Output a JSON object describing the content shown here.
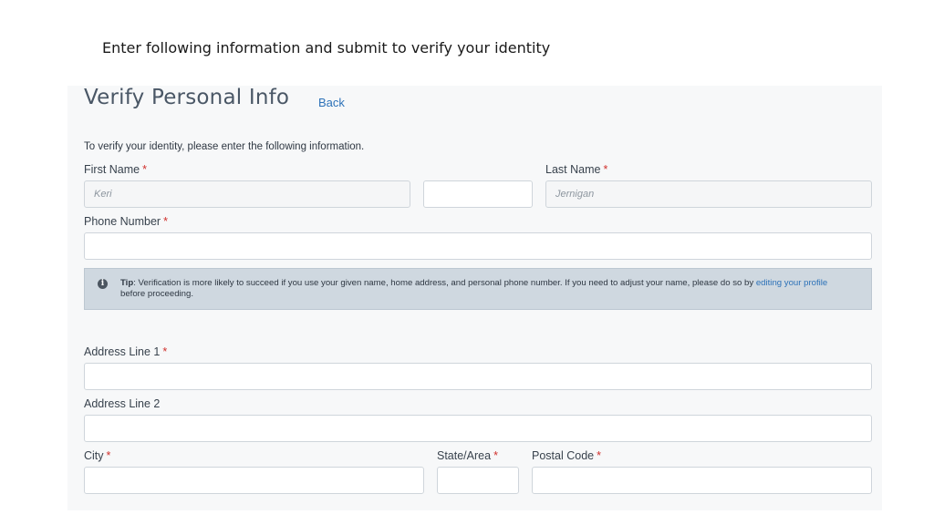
{
  "caption": "Enter following information and submit to verify your identity",
  "form": {
    "title": "Verify Personal Info",
    "back_label": "Back",
    "intro": "To verify your identity, please enter the following information.",
    "required_marker": "*",
    "fields": {
      "first_name": {
        "label": "First Name",
        "placeholder": "Keri",
        "value": ""
      },
      "middle_name": {
        "placeholder": "",
        "value": ""
      },
      "last_name": {
        "label": "Last Name",
        "placeholder": "Jernigan",
        "value": ""
      },
      "phone": {
        "label": "Phone Number",
        "value": ""
      },
      "address1": {
        "label": "Address Line 1",
        "value": ""
      },
      "address2": {
        "label": "Address Line 2",
        "value": ""
      },
      "city": {
        "label": "City",
        "value": ""
      },
      "state": {
        "label": "State/Area",
        "value": ""
      },
      "postal": {
        "label": "Postal Code",
        "value": ""
      }
    },
    "tip": {
      "icon": "info-icon",
      "prefix": "Tip",
      "text": ": Verification is more likely to succeed if you use your given name, home address, and personal phone number. If you need to adjust your name, please do so by ",
      "link_text": "editing your profile",
      "suffix": " before proceeding."
    }
  }
}
